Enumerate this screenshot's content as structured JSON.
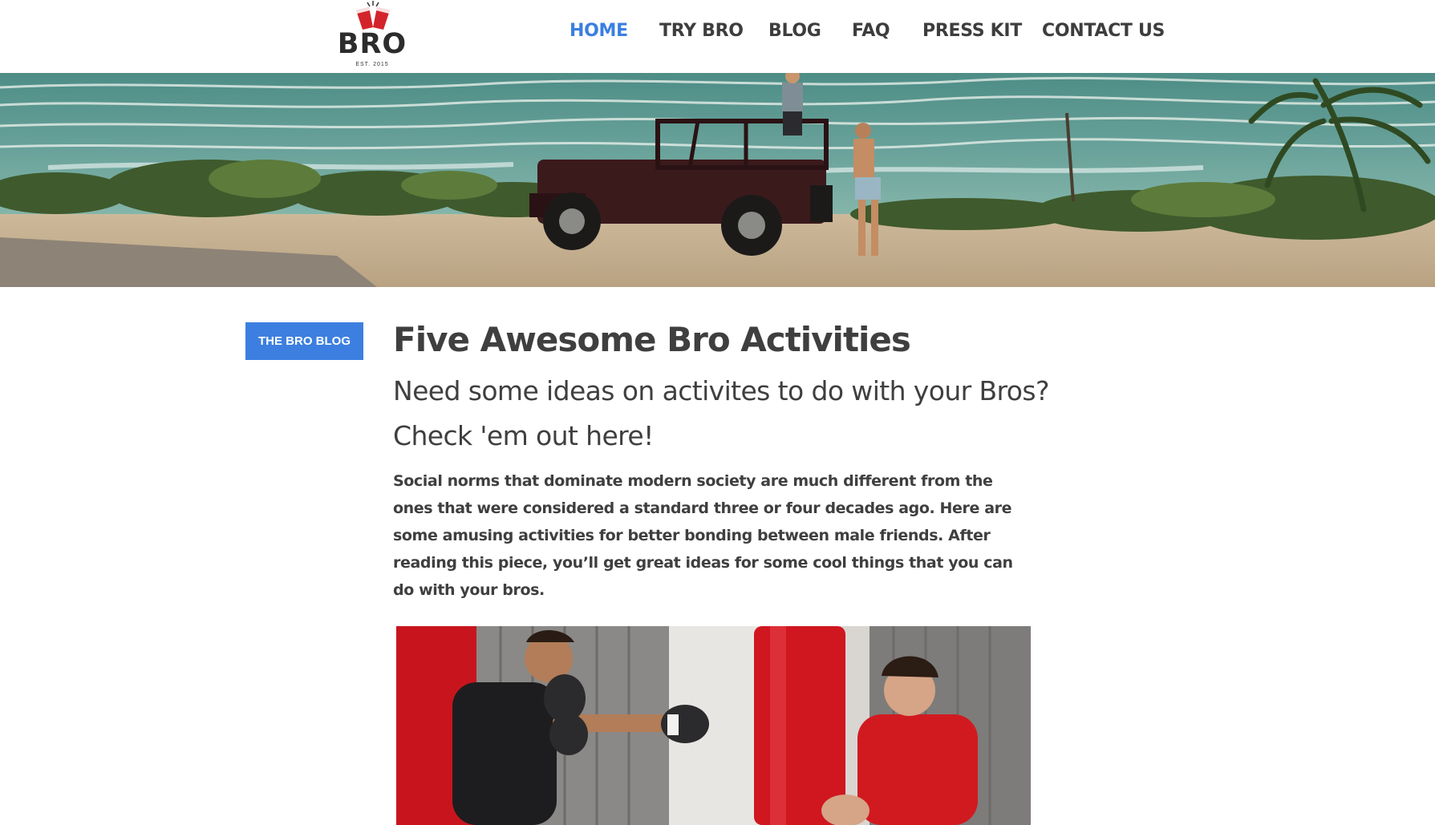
{
  "brand": {
    "name": "BRO",
    "tagline": "EST. 2015"
  },
  "nav": {
    "items": [
      {
        "label": "HOME",
        "active": true
      },
      {
        "label": "TRY BRO",
        "active": false
      },
      {
        "label": "BLOG",
        "active": false
      },
      {
        "label": "FAQ",
        "active": false
      },
      {
        "label": "PRESS KIT",
        "active": false
      },
      {
        "label": "CONTACT US",
        "active": false
      }
    ]
  },
  "sidebar": {
    "badge_label": "THE BRO BLOG"
  },
  "post": {
    "title": "Five Awesome Bro Activities",
    "subtitle": "Need some ideas on activites to do with your Bros? Check 'em out here!",
    "intro": "Social norms that dominate modern society are much different from the ones that were considered a standard three or four decades ago. Here are some amusing activities for better bonding between male friends. After reading this piece, you’ll get great ideas for some cool things that you can do with your bros."
  },
  "colors": {
    "accent": "#3c7fe0",
    "text": "#3f3f3f",
    "logo_red": "#d3242b"
  },
  "images": {
    "hero": "beach-jeep-photo",
    "post": "boxing-training-photo"
  }
}
